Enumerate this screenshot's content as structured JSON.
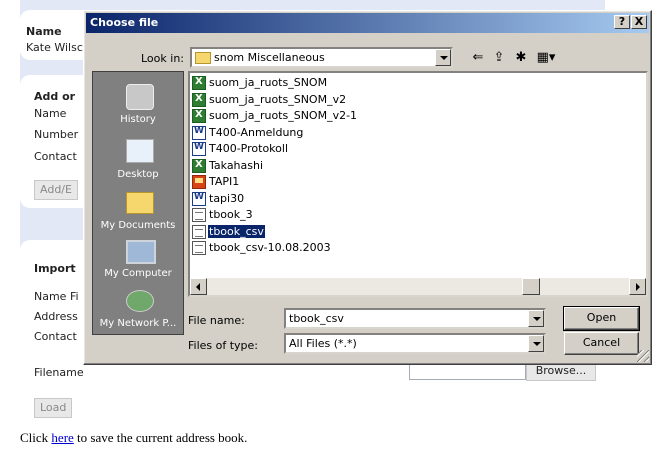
{
  "page": {
    "name_section": {
      "label": "Name",
      "value": "Kate Wilsc"
    },
    "add_section": {
      "heading": "Add or",
      "labels": [
        "Name",
        "Number",
        "Contact"
      ],
      "button": "Add/E"
    },
    "import_section": {
      "heading": "Import",
      "labels": [
        "Name Fi",
        "Address",
        "Contact"
      ],
      "filename_label": "Filename",
      "browse_button": "Browse...",
      "load_button": "Load"
    },
    "footer": {
      "before": "Click ",
      "link": "here",
      "after": " to save the current address book."
    }
  },
  "dialog": {
    "title": "Choose file",
    "help_button": "?",
    "close_button": "X",
    "look_in_label": "Look in:",
    "look_in_value": "snom Miscellaneous",
    "toolbar_icons": [
      "back-icon",
      "up-folder-icon",
      "new-folder-icon",
      "view-menu-icon"
    ],
    "places": [
      {
        "label": "History",
        "icon": "history-icon"
      },
      {
        "label": "Desktop",
        "icon": "desktop-icon"
      },
      {
        "label": "My Documents",
        "icon": "my-documents-icon"
      },
      {
        "label": "My Computer",
        "icon": "my-computer-icon"
      },
      {
        "label": "My Network P...",
        "icon": "my-network-places-icon"
      }
    ],
    "files": [
      {
        "name": "suom_ja_ruots_SNOM",
        "type": "xls"
      },
      {
        "name": "suom_ja_ruots_SNOM_v2",
        "type": "xls"
      },
      {
        "name": "suom_ja_ruots_SNOM_v2-1",
        "type": "xls"
      },
      {
        "name": "T400-Anmeldung",
        "type": "doc"
      },
      {
        "name": "T400-Protokoll",
        "type": "doc"
      },
      {
        "name": "Takahashi",
        "type": "xls"
      },
      {
        "name": "TAPI1",
        "type": "ppt"
      },
      {
        "name": "tapi30",
        "type": "doc"
      },
      {
        "name": "tbook_3",
        "type": "txt"
      },
      {
        "name": "tbook_csv",
        "type": "txt",
        "selected": true
      },
      {
        "name": "tbook_csv-10.08.2003",
        "type": "txt"
      }
    ],
    "file_name_label": "File name:",
    "file_name_value": "tbook_csv",
    "files_of_type_label": "Files of type:",
    "files_of_type_value": "All Files (*.*)",
    "open_button": "Open",
    "cancel_button": "Cancel"
  }
}
